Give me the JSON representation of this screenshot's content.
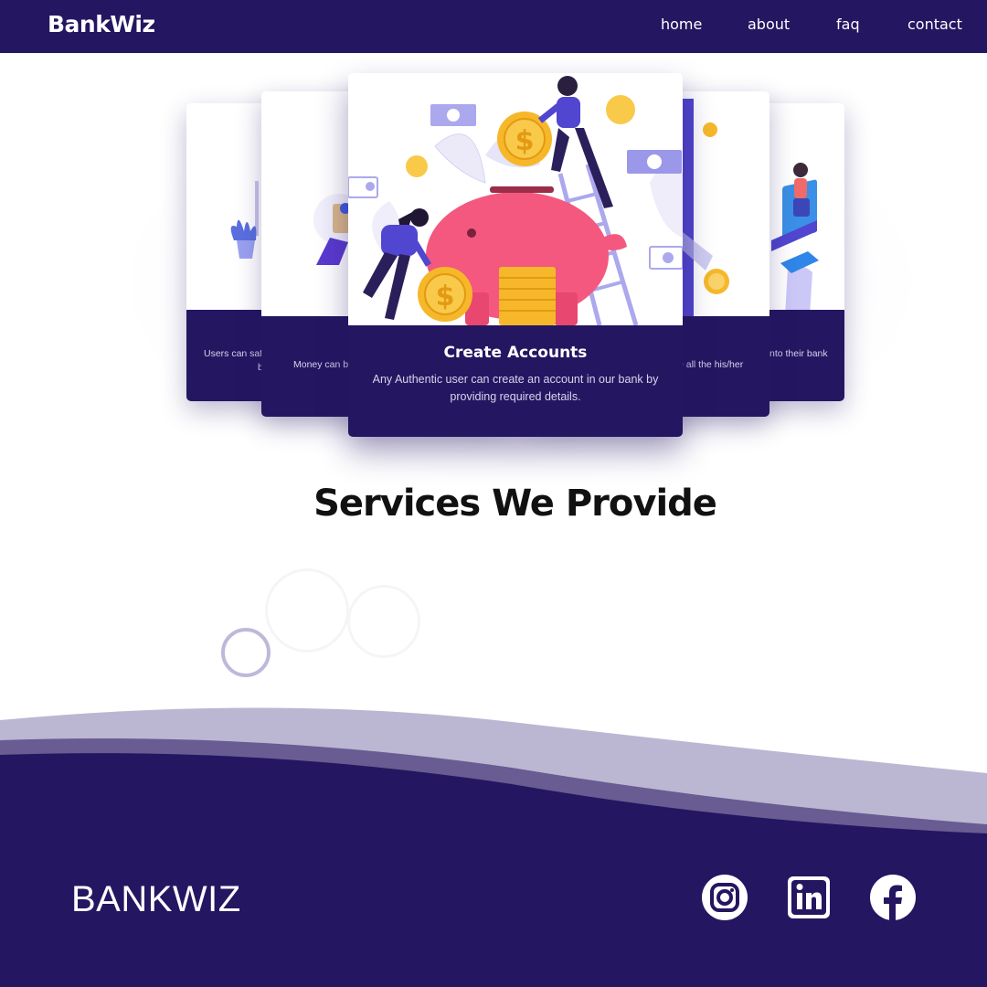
{
  "navbar": {
    "brand": "BankWiz",
    "links": [
      "home",
      "about",
      "faq",
      "contact"
    ]
  },
  "services": {
    "heading": "Services We Provide",
    "cards": [
      {
        "title": "Create Accounts",
        "description": "Any Authentic user can create an account in our bank by providing required details."
      },
      {
        "caption_fragment": "Users can saf"
      },
      {
        "caption_fragment": "b"
      },
      {
        "caption_fragment": "Money can b"
      },
      {
        "caption_fragment": "e all the his/her"
      },
      {
        "caption_fragment": "nto their bank"
      }
    ]
  },
  "footer": {
    "brand": "BANKWIZ",
    "social_icons": [
      "instagram-icon",
      "linkedin-icon",
      "facebook-icon"
    ]
  },
  "colors": {
    "primary": "#251661",
    "accent": "#4b3fc9",
    "wave_light": "#b9b5cf",
    "coin": "#f6b82a",
    "piggy": "#f4587e"
  }
}
